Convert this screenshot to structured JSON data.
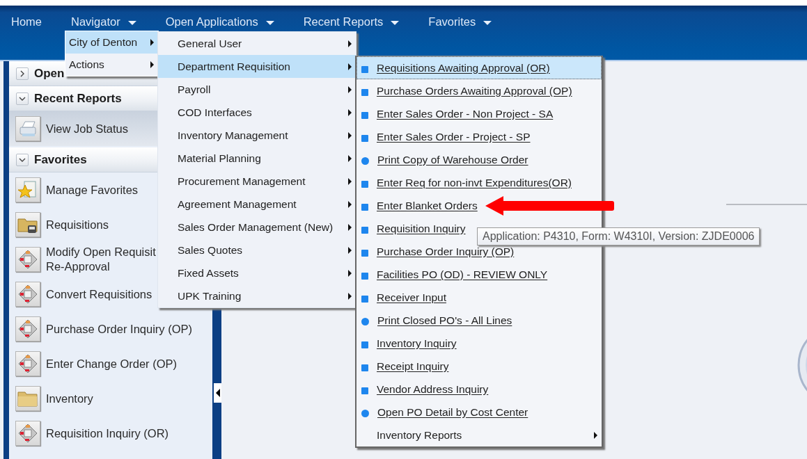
{
  "nav": {
    "items": [
      {
        "label": "Home",
        "dropdown": false
      },
      {
        "label": "Navigator",
        "dropdown": true
      },
      {
        "label": "Open Applications",
        "dropdown": true
      },
      {
        "label": "Recent Reports",
        "dropdown": true
      },
      {
        "label": "Favorites",
        "dropdown": true
      }
    ]
  },
  "sidebar": {
    "sections": [
      {
        "title": "Open",
        "expanded": false
      },
      {
        "title": "Recent Reports",
        "expanded": true,
        "items": [
          {
            "label": "View Job Status",
            "kind": "report"
          }
        ]
      },
      {
        "title": "Favorites",
        "expanded": true,
        "items": [
          {
            "label": "Manage Favorites",
            "kind": "favorites"
          },
          {
            "label": "Requisitions",
            "kind": "folder-app"
          },
          {
            "label": "Modify Open Requisit\nRe-Approval",
            "kind": "application"
          },
          {
            "label": "Convert Requisitions",
            "kind": "application"
          },
          {
            "label": "Purchase Order Inquiry (OP)",
            "kind": "application"
          },
          {
            "label": "Enter Change Order (OP)",
            "kind": "application"
          },
          {
            "label": "Inventory",
            "kind": "folder"
          },
          {
            "label": "Requisition Inquiry (OR)",
            "kind": "application"
          }
        ]
      }
    ]
  },
  "menus": [
    {
      "items": [
        {
          "label": "City of Denton",
          "selected": true,
          "submenu": true
        },
        {
          "label": "Actions",
          "selected": false,
          "submenu": true
        }
      ]
    },
    {
      "items": [
        {
          "label": "General User",
          "selected": false,
          "submenu": true
        },
        {
          "label": "Department Requisition",
          "selected": true,
          "submenu": true
        },
        {
          "label": "Payroll",
          "selected": false,
          "submenu": true
        },
        {
          "label": "COD Interfaces",
          "selected": false,
          "submenu": true
        },
        {
          "label": "Inventory Management",
          "selected": false,
          "submenu": true
        },
        {
          "label": "Material Planning",
          "selected": false,
          "submenu": true
        },
        {
          "label": "Procurement Management",
          "selected": false,
          "submenu": true
        },
        {
          "label": "Agreement Management",
          "selected": false,
          "submenu": true
        },
        {
          "label": "Sales Order Management (New)",
          "selected": false,
          "submenu": true
        },
        {
          "label": "Sales Quotes",
          "selected": false,
          "submenu": true
        },
        {
          "label": "Fixed Assets",
          "selected": false,
          "submenu": true
        },
        {
          "label": "UPK Training",
          "selected": false,
          "submenu": true
        }
      ]
    },
    {
      "items": [
        {
          "label": "Requisitions Awaiting Approval (OR)",
          "kind": "form",
          "selected": true
        },
        {
          "label": "Purchase Orders Awaiting Approval (OP)",
          "kind": "form",
          "selected": false
        },
        {
          "label": "Enter Sales Order - Non Project - SA",
          "kind": "form",
          "selected": false
        },
        {
          "label": "Enter Sales Order - Project - SP",
          "kind": "form",
          "selected": false
        },
        {
          "label": "Print Copy of Warehouse Order",
          "kind": "report",
          "selected": false
        },
        {
          "label": "Enter Req for non-invt Expenditures(OR)",
          "kind": "form",
          "selected": false
        },
        {
          "label": "Enter Blanket Orders",
          "kind": "form",
          "selected": false
        },
        {
          "label": "Requisition Inquiry",
          "kind": "form",
          "selected": false
        },
        {
          "label": "Purchase Order Inquiry (OP)",
          "kind": "form",
          "selected": false
        },
        {
          "label": "Facilities PO (OD) - REVIEW ONLY",
          "kind": "form",
          "selected": false
        },
        {
          "label": "Receiver Input",
          "kind": "form",
          "selected": false
        },
        {
          "label": "Print Closed PO's - All Lines",
          "kind": "report",
          "selected": false
        },
        {
          "label": "Inventory Inquiry",
          "kind": "form",
          "selected": false
        },
        {
          "label": "Receipt Inquiry",
          "kind": "form",
          "selected": false
        },
        {
          "label": "Vendor Address Inquiry",
          "kind": "form",
          "selected": false
        },
        {
          "label": "Open PO Detail by Cost Center",
          "kind": "report",
          "selected": false
        },
        {
          "label": "Inventory Reports",
          "kind": "submenu",
          "selected": false
        }
      ]
    }
  ],
  "tooltip": {
    "text": "Application: P4310, Form: W4310I, Version: ZJDE0006"
  }
}
